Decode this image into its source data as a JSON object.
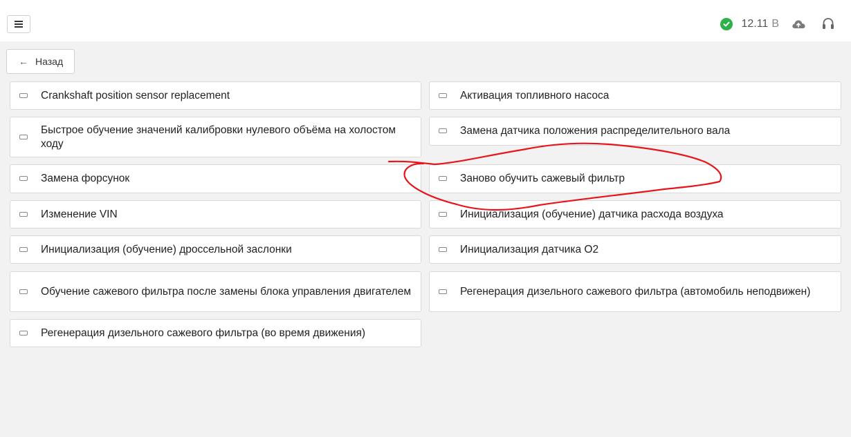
{
  "header": {
    "menu_icon": "hamburger-menu-icon",
    "status_icon": "check-circle-icon",
    "status_color": "#2db14a",
    "voltage_value": "12.11",
    "voltage_unit": "В",
    "cloud_icon": "cloud-upload-icon",
    "support_icon": "headset-icon"
  },
  "back": {
    "arrow": "←",
    "label": "Назад"
  },
  "procedures": {
    "left": [
      "Crankshaft position sensor replacement",
      "Быстрое обучение значений калибровки нулевого объёма на холостом ходу",
      "Замена форсунок",
      "Изменение VIN",
      "Инициализация (обучение) дроссельной заслонки",
      "Обучение сажевого фильтра после замены блока управления двигателем",
      "Регенерация дизельного сажевого фильтра (во время движения)"
    ],
    "right": [
      "Активация топливного насоса",
      "Замена датчика положения распределительного вала",
      "Заново обучить сажевый фильтр",
      "Инициализация (обучение) датчика расхода воздуха",
      "Инициализация датчика O2",
      "Регенерация дизельного сажевого фильтра (автомобиль неподвижен)"
    ]
  },
  "annotation_color": "#e8141b"
}
